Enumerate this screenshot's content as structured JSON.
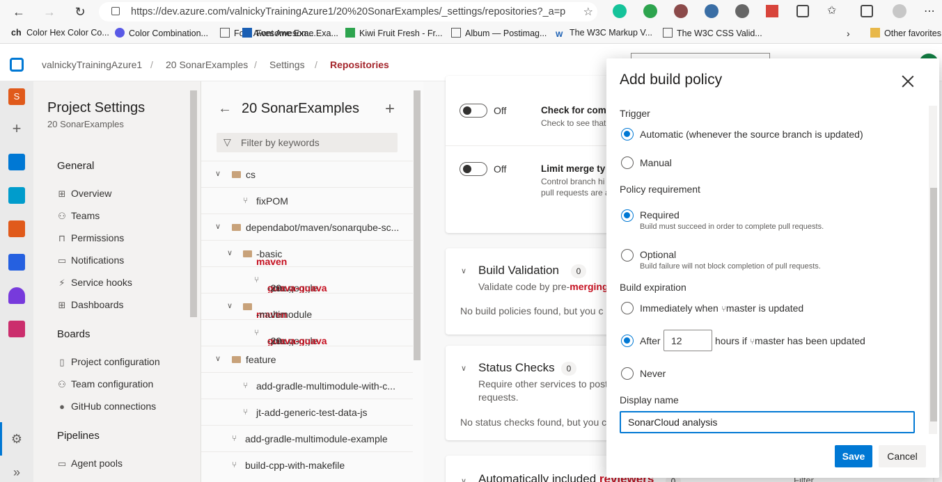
{
  "browser": {
    "url": "https://dev.azure.com/valnickyTrainingAzure1/20%20SonarExamples/_settings/repositories?_a=polic...",
    "bookmarks": [
      "Color Hex Color Co...",
      "Color Combination...",
      "Font Awesome Exa...",
      "Kiwi Fruit Fresh - Fr...",
      "Album — Postimag...",
      "The W3C Markup V...",
      "The W3C CSS Valid..."
    ],
    "other_favorites": "Other favorites",
    "prefix": "ch"
  },
  "header": {
    "org": "valnickyTrainingAzure1",
    "project": "20 SonarExamples",
    "settings": "Settings",
    "current": "Repositories",
    "separator": "/"
  },
  "project_settings": {
    "title": "Project Settings",
    "subtitle": "20 SonarExamples",
    "general": "General",
    "general_items": [
      "Overview",
      "Teams",
      "Permissions",
      "Notifications",
      "Service hooks",
      "Dashboards"
    ],
    "boards": "Boards",
    "boards_items": [
      "Project configuration",
      "Team configuration",
      "GitHub connections"
    ],
    "pipelines": "Pipelines",
    "pipelines_items": [
      "Agent pools"
    ]
  },
  "tree": {
    "title": "20 SonarExamples",
    "filter_placeholder": "Filter by keywords",
    "rows": {
      "cs": "cs",
      "fixpom": "fixPOM",
      "dependabot": "dependabot/maven/sonarqube-sc...",
      "maven_basic_a": "maven",
      "maven_basic_b": "-basic",
      "guava1_a": "com.google.",
      "guava1_b": "guava-guava",
      "guava1_c": "-29...",
      "maven_multi_a": "maven",
      "maven_multi_b": "-multimodule",
      "guava2_a": "com.google.",
      "guava2_b": "guava-guava",
      "guava2_c": "-29...",
      "feature": "feature",
      "add_gradle_c": "add-gradle-multimodule-with-c...",
      "jt_add": "jt-add-generic-test-data-js",
      "add_gradle_ex": "add-gradle-multimodule-example",
      "build_cpp": "build-cpp-with-makefile"
    }
  },
  "main": {
    "toggle1": "Off",
    "check_title": "Check for com",
    "check_desc": "Check to see that",
    "toggle2": "Off",
    "limit_title": "Limit merge ty",
    "limit_desc1": "Control branch hi",
    "limit_desc2": "pull requests are a",
    "build_validation": "Build Validation",
    "build_count": "0",
    "build_desc_a": "Validate code by pre-",
    "build_desc_b": "merging",
    "build_empty": "No build policies found, but you c",
    "status_checks": "Status Checks",
    "status_count": "0",
    "status_desc1": "Require other services to post",
    "status_desc2": "requests.",
    "status_empty": "No status checks found, but you c",
    "auto_a": "Automatically included ",
    "auto_b": "reviewers",
    "auto_count": "0",
    "filter": "Filter"
  },
  "dialog": {
    "title": "Add build policy",
    "trigger_label": "Trigger",
    "trigger_automatic": "Automatic (whenever the source branch is updated)",
    "trigger_manual": "Manual",
    "policy_label": "Policy requirement",
    "required": "Required",
    "required_desc": "Build must succeed in order to complete pull requests.",
    "optional": "Optional",
    "optional_desc": "Build failure will not block completion of pull requests.",
    "expiration_label": "Build expiration",
    "immediately_a": "Immediately when",
    "immediately_b": "master is updated",
    "after": "After",
    "after_value": "12",
    "hours_a": "hours if",
    "hours_b": "master has been updated",
    "never": "Never",
    "display_name_label": "Display name",
    "display_name_value": "SonarCloud analysis",
    "save": "Save",
    "cancel": "Cancel"
  },
  "colors": {
    "accent": "#0078d4",
    "highlight": "#c50f1f"
  }
}
